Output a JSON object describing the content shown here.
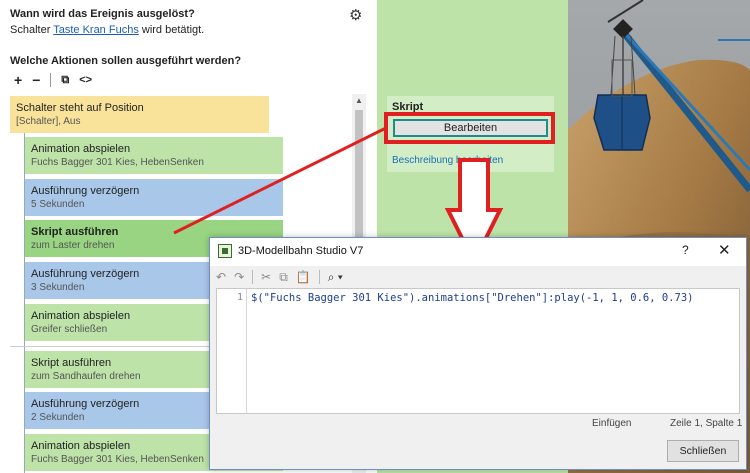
{
  "event": {
    "question_trigger": "Wann wird das Ereignis ausgelöst?",
    "trigger_prefix": "Schalter",
    "trigger_link": "Taste Kran Fuchs",
    "trigger_suffix": "wird betätigt.",
    "question_actions": "Welche Aktionen sollen ausgeführt werden?",
    "toolbar": {
      "add": "+",
      "remove": "−",
      "copy": "⧉",
      "code": "<>"
    }
  },
  "actions": [
    {
      "title": "Schalter steht auf Position",
      "subtitle": "[Schalter], Aus"
    },
    {
      "title": "Animation abspielen",
      "subtitle": "Fuchs Bagger 301 Kies, HebenSenken"
    },
    {
      "title": "Ausführung verzögern",
      "subtitle": "5 Sekunden"
    },
    {
      "title": "Skript ausführen",
      "subtitle": "zum Laster drehen"
    },
    {
      "title": "Ausführung verzögern",
      "subtitle": "3 Sekunden"
    },
    {
      "title": "Animation abspielen",
      "subtitle": "Greifer schließen"
    },
    {
      "title": "Skript ausführen",
      "subtitle": "zum Sandhaufen drehen"
    },
    {
      "title": "Ausführung verzögern",
      "subtitle": "2 Sekunden"
    },
    {
      "title": "Animation abspielen",
      "subtitle": "Fuchs Bagger 301 Kies, HebenSenken"
    }
  ],
  "properties": {
    "section_title": "Skript",
    "edit_button": "Bearbeiten",
    "description_link": "Beschreibung bearbeiten"
  },
  "dialog": {
    "title": "3D-Modellbahn Studio V7",
    "help": "?",
    "close": "✕",
    "line_number": "1",
    "code": "$(\"Fuchs Bagger 301 Kies\").animations[\"Drehen\"]:play(-1, 1, 0.6, 0.73)",
    "status_mode": "Einfügen",
    "status_position": "Zeile 1, Spalte 1",
    "close_button": "Schließen"
  },
  "colors": {
    "trigger_card": "#f9e39b",
    "animation_card": "#bde3a8",
    "delay_card": "#a9c7e8",
    "selected_card": "#98d481",
    "annotation": "#e02020"
  }
}
